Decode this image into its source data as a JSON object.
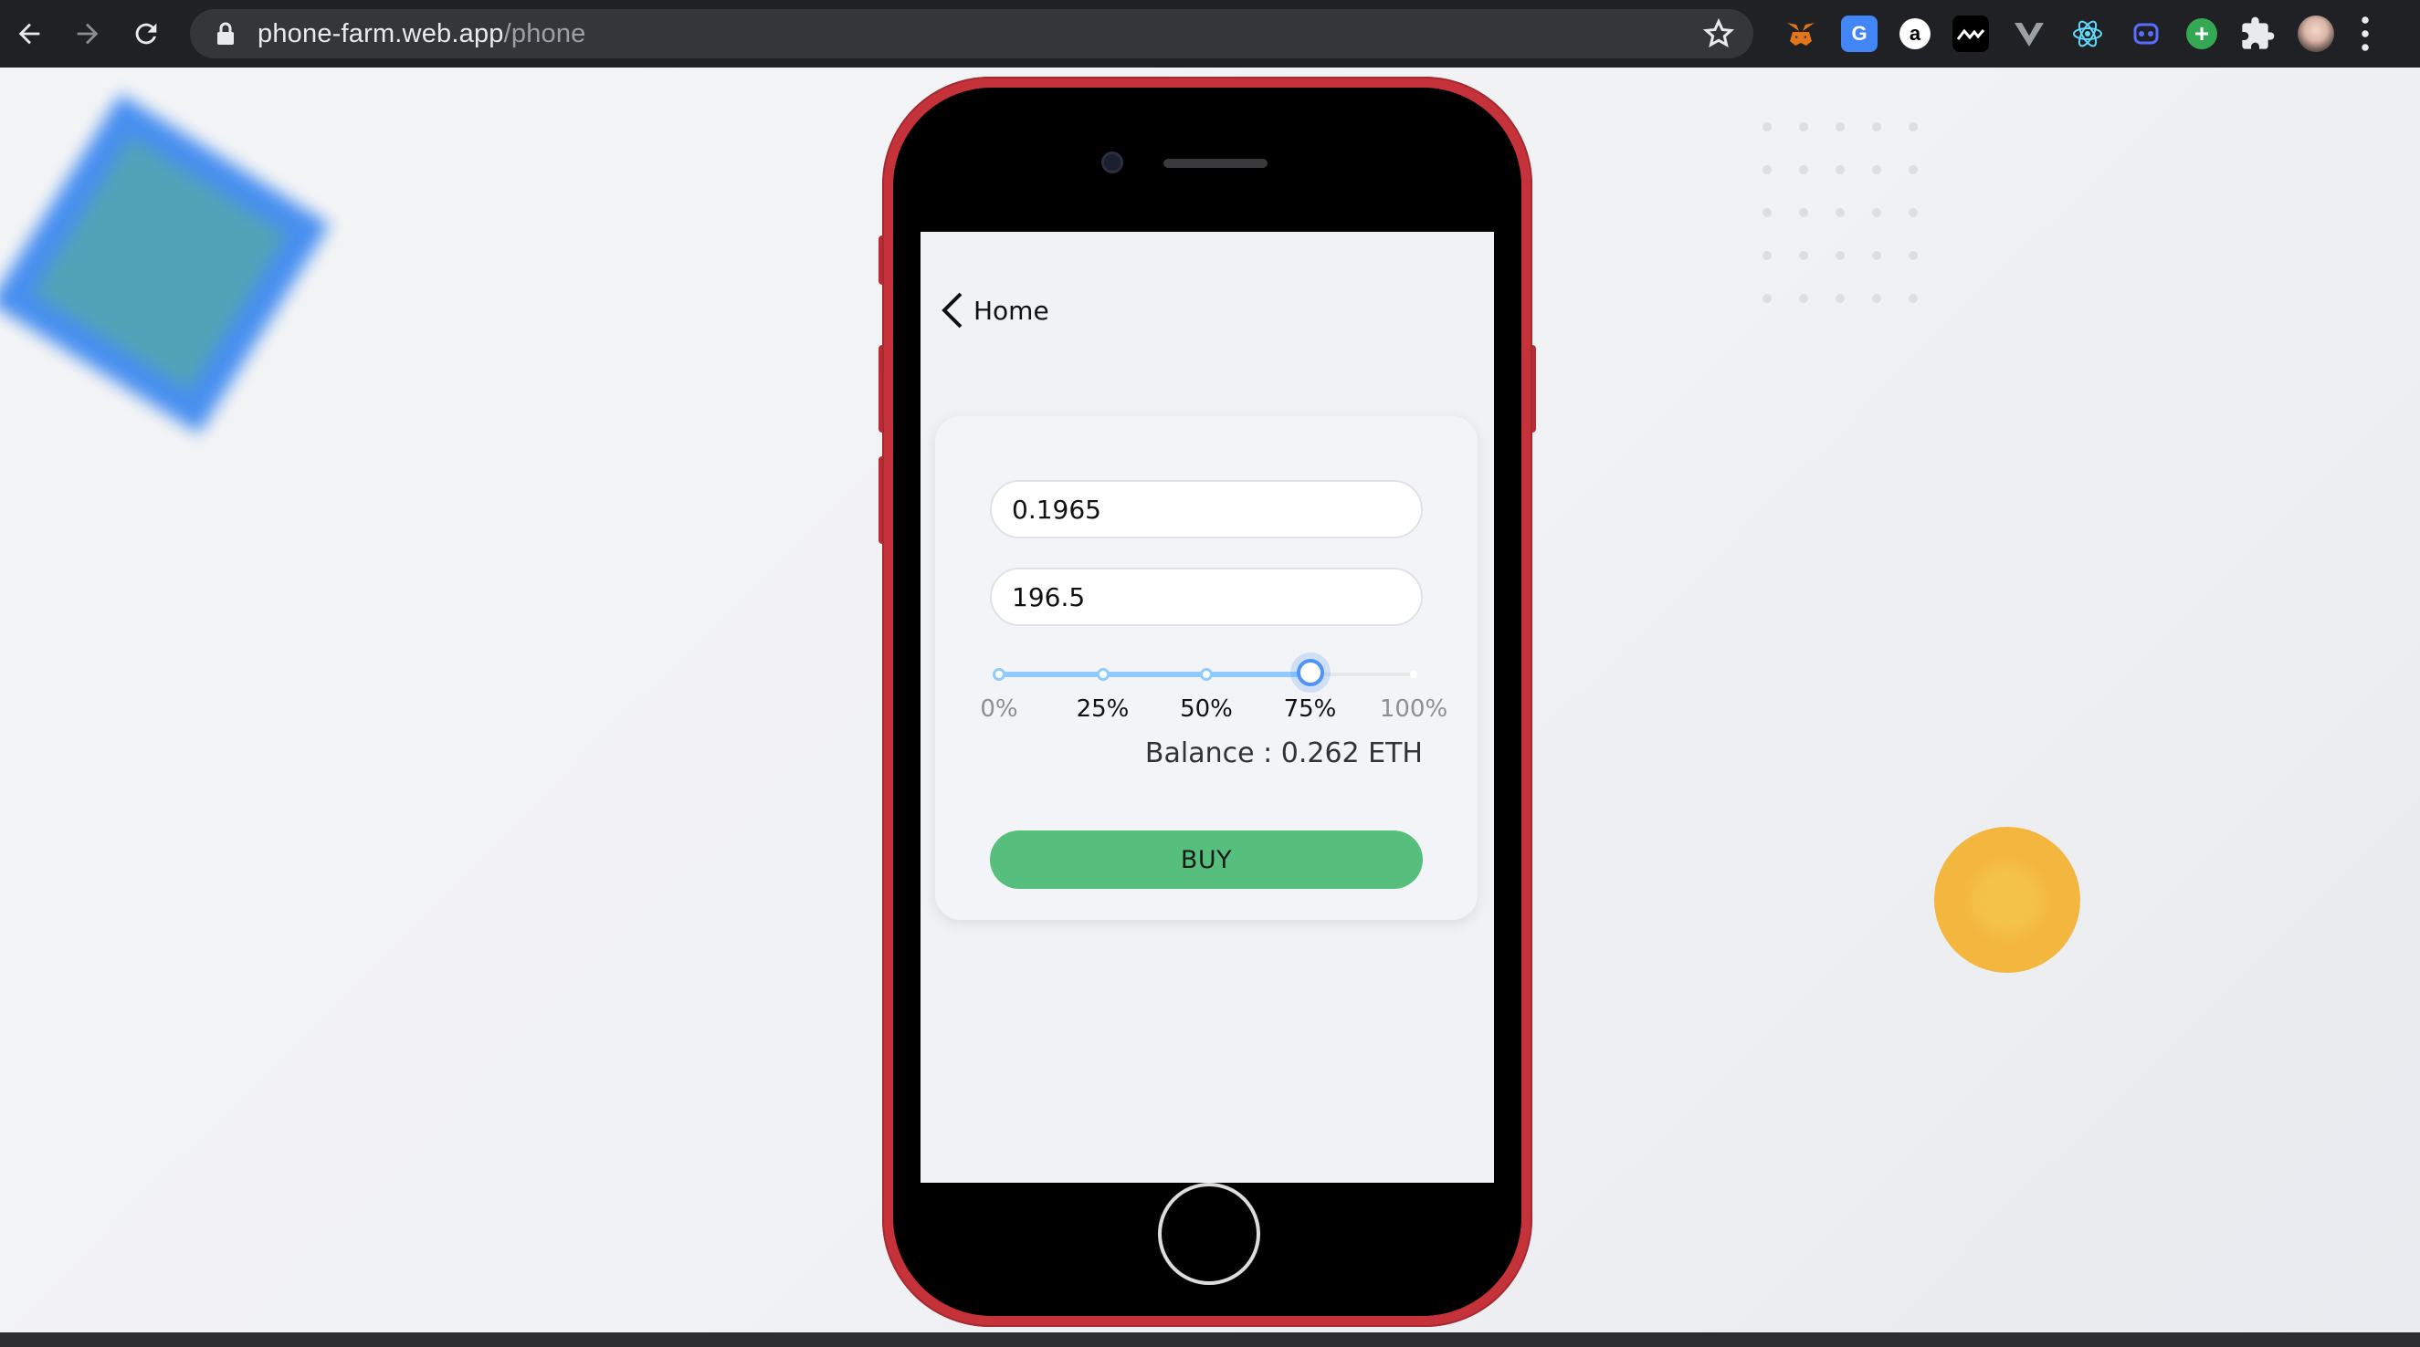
{
  "browser": {
    "url_host": "phone-farm.web.app",
    "url_path": "/phone",
    "icons": [
      "back-arrow-icon",
      "forward-arrow-icon",
      "reload-icon",
      "lock-icon",
      "bookmark-star-icon"
    ],
    "extensions": [
      "metamask-fox-icon",
      "google-translate-icon",
      "a-icon",
      "wave-icon",
      "vue-icon",
      "react-icon",
      "ghost-icon",
      "plus-icon",
      "puzzle-icon",
      "profile-avatar",
      "menu-kebab-icon"
    ],
    "translate_glyph": "G",
    "a_glyph": "a",
    "plus_glyph": "+"
  },
  "app": {
    "back_label": "Home",
    "amount_value": "0.1965",
    "price_value": "196.5",
    "slider": {
      "value_percent": 75,
      "marks": [
        "0%",
        "25%",
        "50%",
        "75%",
        "100%"
      ]
    },
    "balance_text": "Balance : 0.262 ETH",
    "buy_label": "BUY"
  },
  "colors": {
    "phone_body": "#c5323a",
    "buy_button": "#57bf7d",
    "slider_fill": "#91caff",
    "slider_handle": "#4f95f7",
    "deco_square": "#3f8af0",
    "deco_circle": "#f3b63f"
  }
}
